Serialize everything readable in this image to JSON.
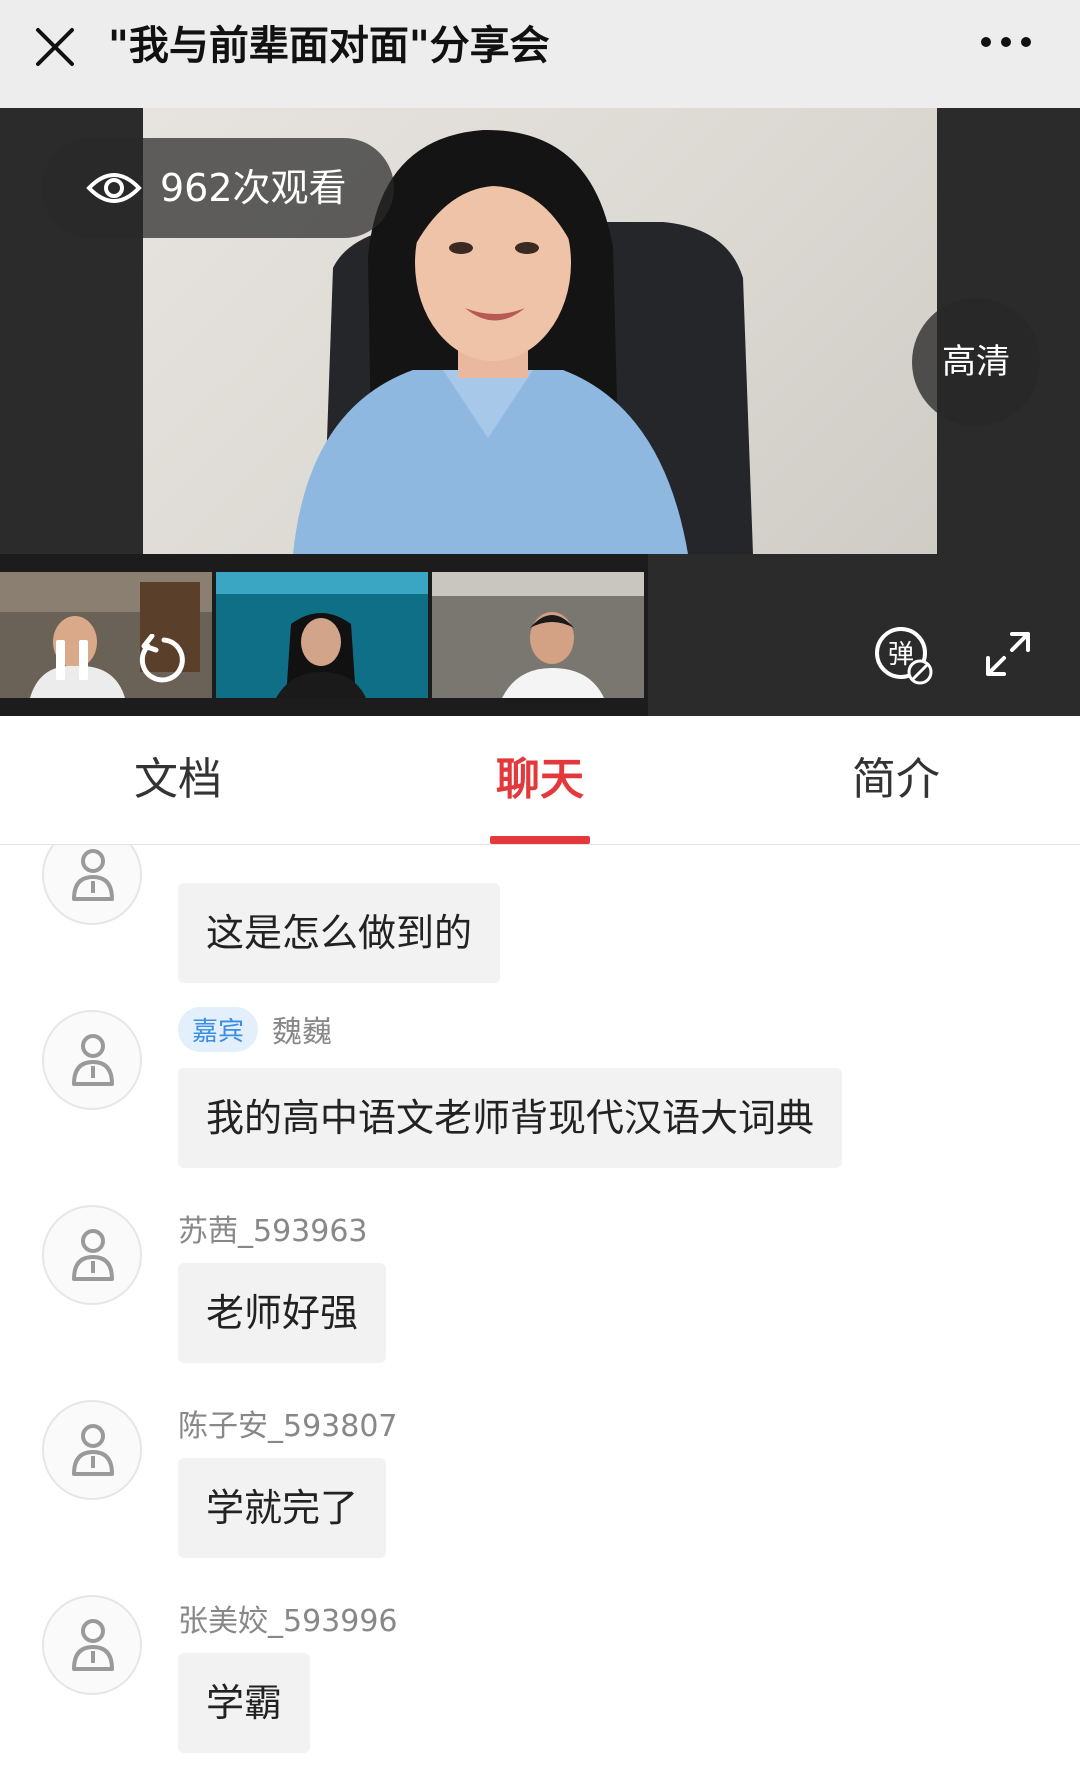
{
  "header": {
    "title": "\"我与前辈面对面\"分享会"
  },
  "video": {
    "views_text": "962次观看",
    "quality_label": "高清",
    "danmaku_label": "弹"
  },
  "tabs": [
    {
      "label": "文档"
    },
    {
      "label": "聊天"
    },
    {
      "label": "简介"
    }
  ],
  "chat": {
    "messages": [
      {
        "user": "",
        "guest": false,
        "text": "这是怎么做到的"
      },
      {
        "user": "魏巍",
        "guest": true,
        "badge": "嘉宾",
        "text": "我的高中语文老师背现代汉语大词典"
      },
      {
        "user": "苏茜_593963",
        "guest": false,
        "text": "老师好强"
      },
      {
        "user": "陈子安_593807",
        "guest": false,
        "text": "学就完了"
      },
      {
        "user": "张美姣_593996",
        "guest": false,
        "text": "学霸"
      }
    ]
  },
  "colors": {
    "accent": "#e4393c",
    "guest_badge_text": "#3a8ee6",
    "guest_badge_bg": "#e3f0fb",
    "header_bg": "#ededed"
  }
}
